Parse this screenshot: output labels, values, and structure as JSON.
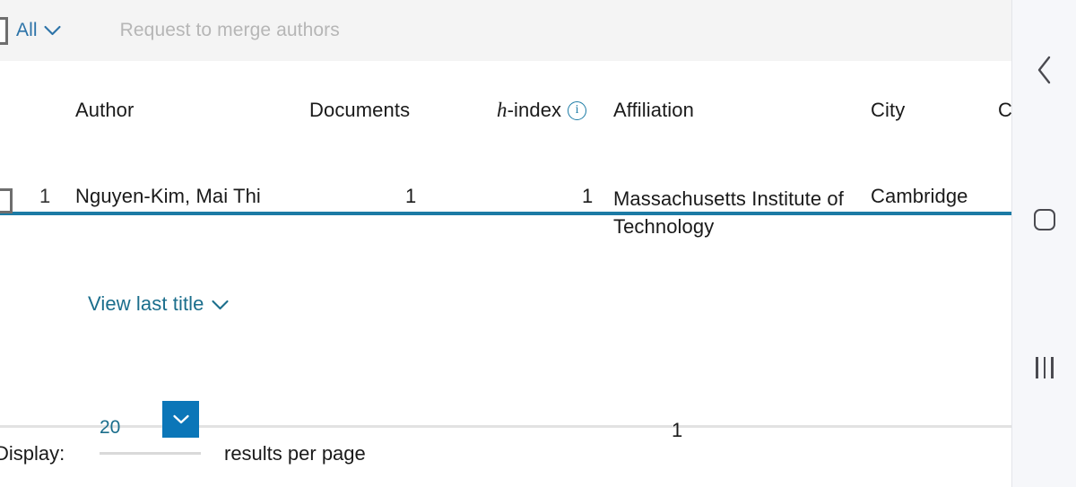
{
  "action_bar": {
    "select_all_label": "All",
    "select_all_caret": "chevron-down-icon",
    "merge_button_label": "Request to merge authors",
    "checkbox_checked": false
  },
  "table": {
    "columns": [
      {
        "key": "author",
        "label": "Author"
      },
      {
        "key": "documents",
        "label": "Documents"
      },
      {
        "key": "hindex",
        "label": "h-index",
        "label_italic_prefix": "h",
        "label_rest": "-index",
        "info_icon": "info-circle-icon"
      },
      {
        "key": "affiliation",
        "label": "Affiliation"
      },
      {
        "key": "city",
        "label": "City"
      },
      {
        "key": "country",
        "label": "C"
      }
    ],
    "rows": [
      {
        "index": "1",
        "author": "Nguyen-Kim, Mai Thi",
        "documents": "1",
        "hindex": "1",
        "affiliation": "Massachusetts Institute of Technology",
        "city": "Cambridge",
        "checkbox_checked": false
      }
    ],
    "view_last_title_label": "View last title",
    "view_last_title_caret": "chevron-down-icon"
  },
  "footer": {
    "display_label": "Display:",
    "results_per_page_value": "20",
    "results_per_page_suffix": "results per page",
    "dropdown_icon": "chevron-down-icon",
    "current_page": "1"
  },
  "navbar": {
    "back_icon": "chevron-left-icon",
    "home_icon": "home-square-icon",
    "recents_icon": "recents-bars-icon"
  },
  "colors": {
    "accent_teal": "#1c7ba5",
    "link_teal": "#1b6e8c",
    "select_blue": "#0b76b8",
    "header_band": "#f4f4f4",
    "muted_text": "#b6b6b6"
  }
}
